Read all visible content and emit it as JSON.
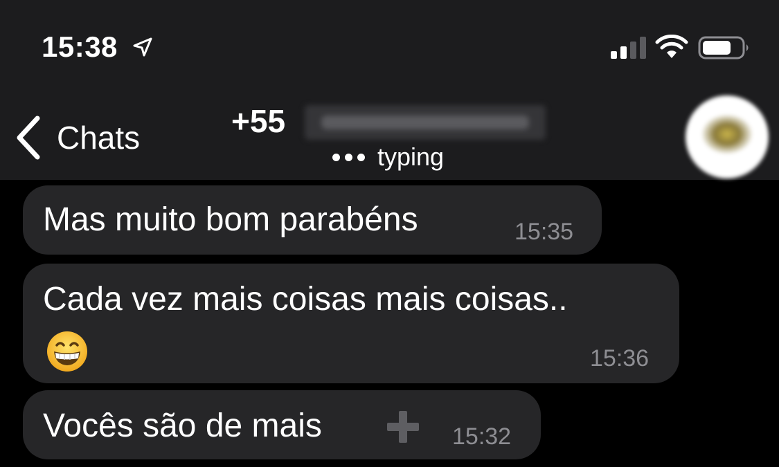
{
  "status_bar": {
    "time": "15:38",
    "icons": [
      "location-arrow-icon",
      "cellular-signal-icon",
      "wifi-icon",
      "battery-icon"
    ]
  },
  "nav": {
    "back_label": "Chats",
    "contact_prefix": "+55",
    "status": "typing"
  },
  "messages": [
    {
      "text": "Mas muito bom parabéns",
      "time": "15:35"
    },
    {
      "text": "Cada vez mais coisas mais coisas..",
      "emoji": "grinning-face-emoji",
      "time": "15:36"
    },
    {
      "text": "Vocês são de mais",
      "icon": "heavy-plus-icon",
      "time": "15:32"
    }
  ],
  "colors": {
    "header_bg": "#1c1c1e",
    "chat_bg": "#000000",
    "bubble_bg": "#262628",
    "timestamp": "#8e8e93",
    "text": "#ffffff"
  }
}
